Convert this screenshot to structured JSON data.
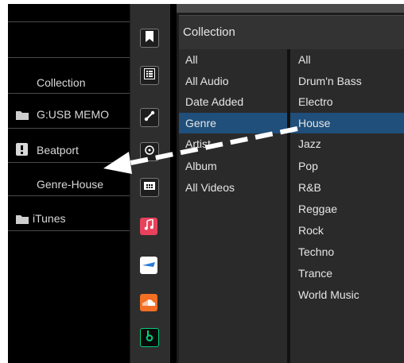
{
  "left_panel": {
    "items": [
      {
        "label": "Collection",
        "icon": ""
      },
      {
        "label": "G:USB MEMO",
        "icon": "folder-icon"
      },
      {
        "label": "Beatport",
        "icon": "beatport-icon"
      },
      {
        "label": "Genre-House",
        "icon": ""
      },
      {
        "label": "iTunes",
        "icon": "folder-icon"
      }
    ]
  },
  "icon_column": {
    "buttons": [
      "bookmark-icon",
      "playlist-icon",
      "hotcue-icon",
      "related-icon",
      "grid-icon",
      "itunes-icon",
      "tidal-icon",
      "soundcloud-icon",
      "beatport-icon"
    ]
  },
  "browser": {
    "header": "Collection",
    "column1": [
      "All",
      "All Audio",
      "Date Added",
      "Genre",
      "Artist",
      "Album",
      "All Videos"
    ],
    "column1_selected": "Genre",
    "column2": [
      "All",
      "Drum'n Bass",
      "Electro",
      "House",
      "Jazz",
      "Pop",
      "R&B",
      "Reggae",
      "Rock",
      "Techno",
      "Trance",
      "World Music"
    ],
    "column2_selected": "House"
  },
  "colors": {
    "selection": "#1f4f7a",
    "arrow": "#ffffff"
  }
}
